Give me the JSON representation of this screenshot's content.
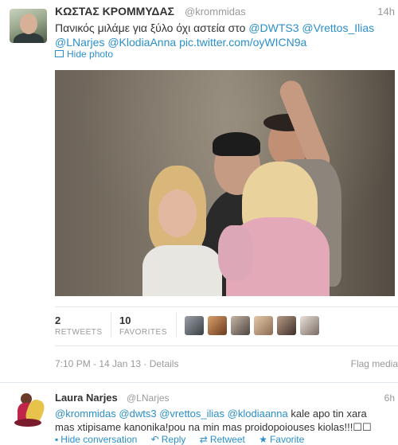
{
  "tweet1": {
    "author_name": "ΚΩΣΤΑΣ ΚΡΟΜΜΥΔΑΣ",
    "handle": "@krommidas",
    "time": "14h",
    "text_plain": "Πανικός μιλάμε για ξύλο όχι αστεία στο",
    "mentions": [
      "@DWTS3",
      "@Vrettos_Ilias",
      "@LNarjes",
      "@KlodiaAnna"
    ],
    "link": "pic.twitter.com/oyWICN9a",
    "hide_photo": "Hide photo",
    "stats": {
      "retweets_count": "2",
      "retweets_label": "RETWEETS",
      "favorites_count": "10",
      "favorites_label": "FAVORITES"
    },
    "timestamp": "7:10 PM - 14 Jan 13",
    "separator": "·",
    "details": "Details",
    "flag_media": "Flag media"
  },
  "tweet2": {
    "author_name": "Laura Narjes",
    "handle": "@LNarjes",
    "time": "6h",
    "mentions": [
      "@krommidas",
      "@dwts3",
      "@vrettos_ilias",
      "@klodiaanna"
    ],
    "text_line1_tail": "kale apo tin xara",
    "text_line2": "mas xtipisame kanonika!pou na min mas proidopoiouses kiolas!!!☐☐",
    "actions": {
      "hide_conversation": "Hide conversation",
      "reply": "Reply",
      "retweet": "Retweet",
      "favorite": "Favorite"
    }
  },
  "icons": {
    "photo": "photo-icon",
    "reply": "reply-icon",
    "retweet": "retweet-icon",
    "favorite": "star-icon",
    "conversation": "conversation-icon"
  },
  "colors": {
    "link": "#2a8fcb",
    "muted": "#999999",
    "text": "#333333"
  }
}
